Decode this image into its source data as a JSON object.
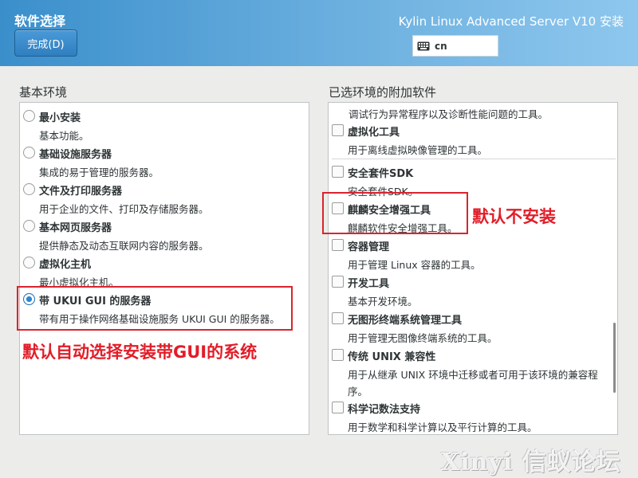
{
  "header": {
    "title": "软件选择",
    "done_button": "完成(D)",
    "product": "Kylin Linux Advanced Server V10 安装",
    "keyboard_layout": "cn",
    "colors": {
      "header_left": "#3a8fcb",
      "header_right": "#8ec7ee",
      "button": "#2f7fc0"
    }
  },
  "left": {
    "heading": "基本环境",
    "options": [
      {
        "title": "最小安装",
        "desc": "基本功能。",
        "selected": false
      },
      {
        "title": "基础设施服务器",
        "desc": "集成的易于管理的服务器。",
        "selected": false
      },
      {
        "title": "文件及打印服务器",
        "desc": "用于企业的文件、打印及存储服务器。",
        "selected": false
      },
      {
        "title": "基本网页服务器",
        "desc": "提供静态及动态互联网内容的服务器。",
        "selected": false
      },
      {
        "title": "虚拟化主机",
        "desc": "最小虚拟化主机。",
        "selected": false
      },
      {
        "title": "带 UKUI GUI 的服务器",
        "desc": "带有用于操作网络基础设施服务 UKUI GUI 的服务器。",
        "selected": true
      }
    ]
  },
  "right": {
    "heading": "已选环境的附加软件",
    "partial_desc": "调试行为异常程序以及诊断性能问题的工具。",
    "addons": [
      {
        "title": "虚拟化工具",
        "desc": "用于离线虚拟映像管理的工具。",
        "checked": false
      },
      {
        "title": "安全套件SDK",
        "desc": "安全套件SDK。",
        "checked": false
      },
      {
        "title": "麒麟安全增强工具",
        "desc": "麒麟软件安全增强工具。",
        "checked": false
      },
      {
        "title": "容器管理",
        "desc": "用于管理 Linux 容器的工具。",
        "checked": false
      },
      {
        "title": "开发工具",
        "desc": "基本开发环境。",
        "checked": false
      },
      {
        "title": "无图形终端系统管理工具",
        "desc": "用于管理无图像终端系统的工具。",
        "checked": false
      },
      {
        "title": "传统 UNIX 兼容性",
        "desc": "用于从继承 UNIX 环境中迁移或者可用于该环境的兼容程",
        "desc2": "序。",
        "checked": false
      },
      {
        "title": "科学记数法支持",
        "desc": "用于数学和科学计算以及平行计算的工具。",
        "checked": false
      }
    ]
  },
  "annotations": {
    "right_note": "默认不安装",
    "left_note": "默认自动选择安装带GUI的系统",
    "color": "#e21d28"
  },
  "watermark": "Xinyi 信蚁论坛"
}
